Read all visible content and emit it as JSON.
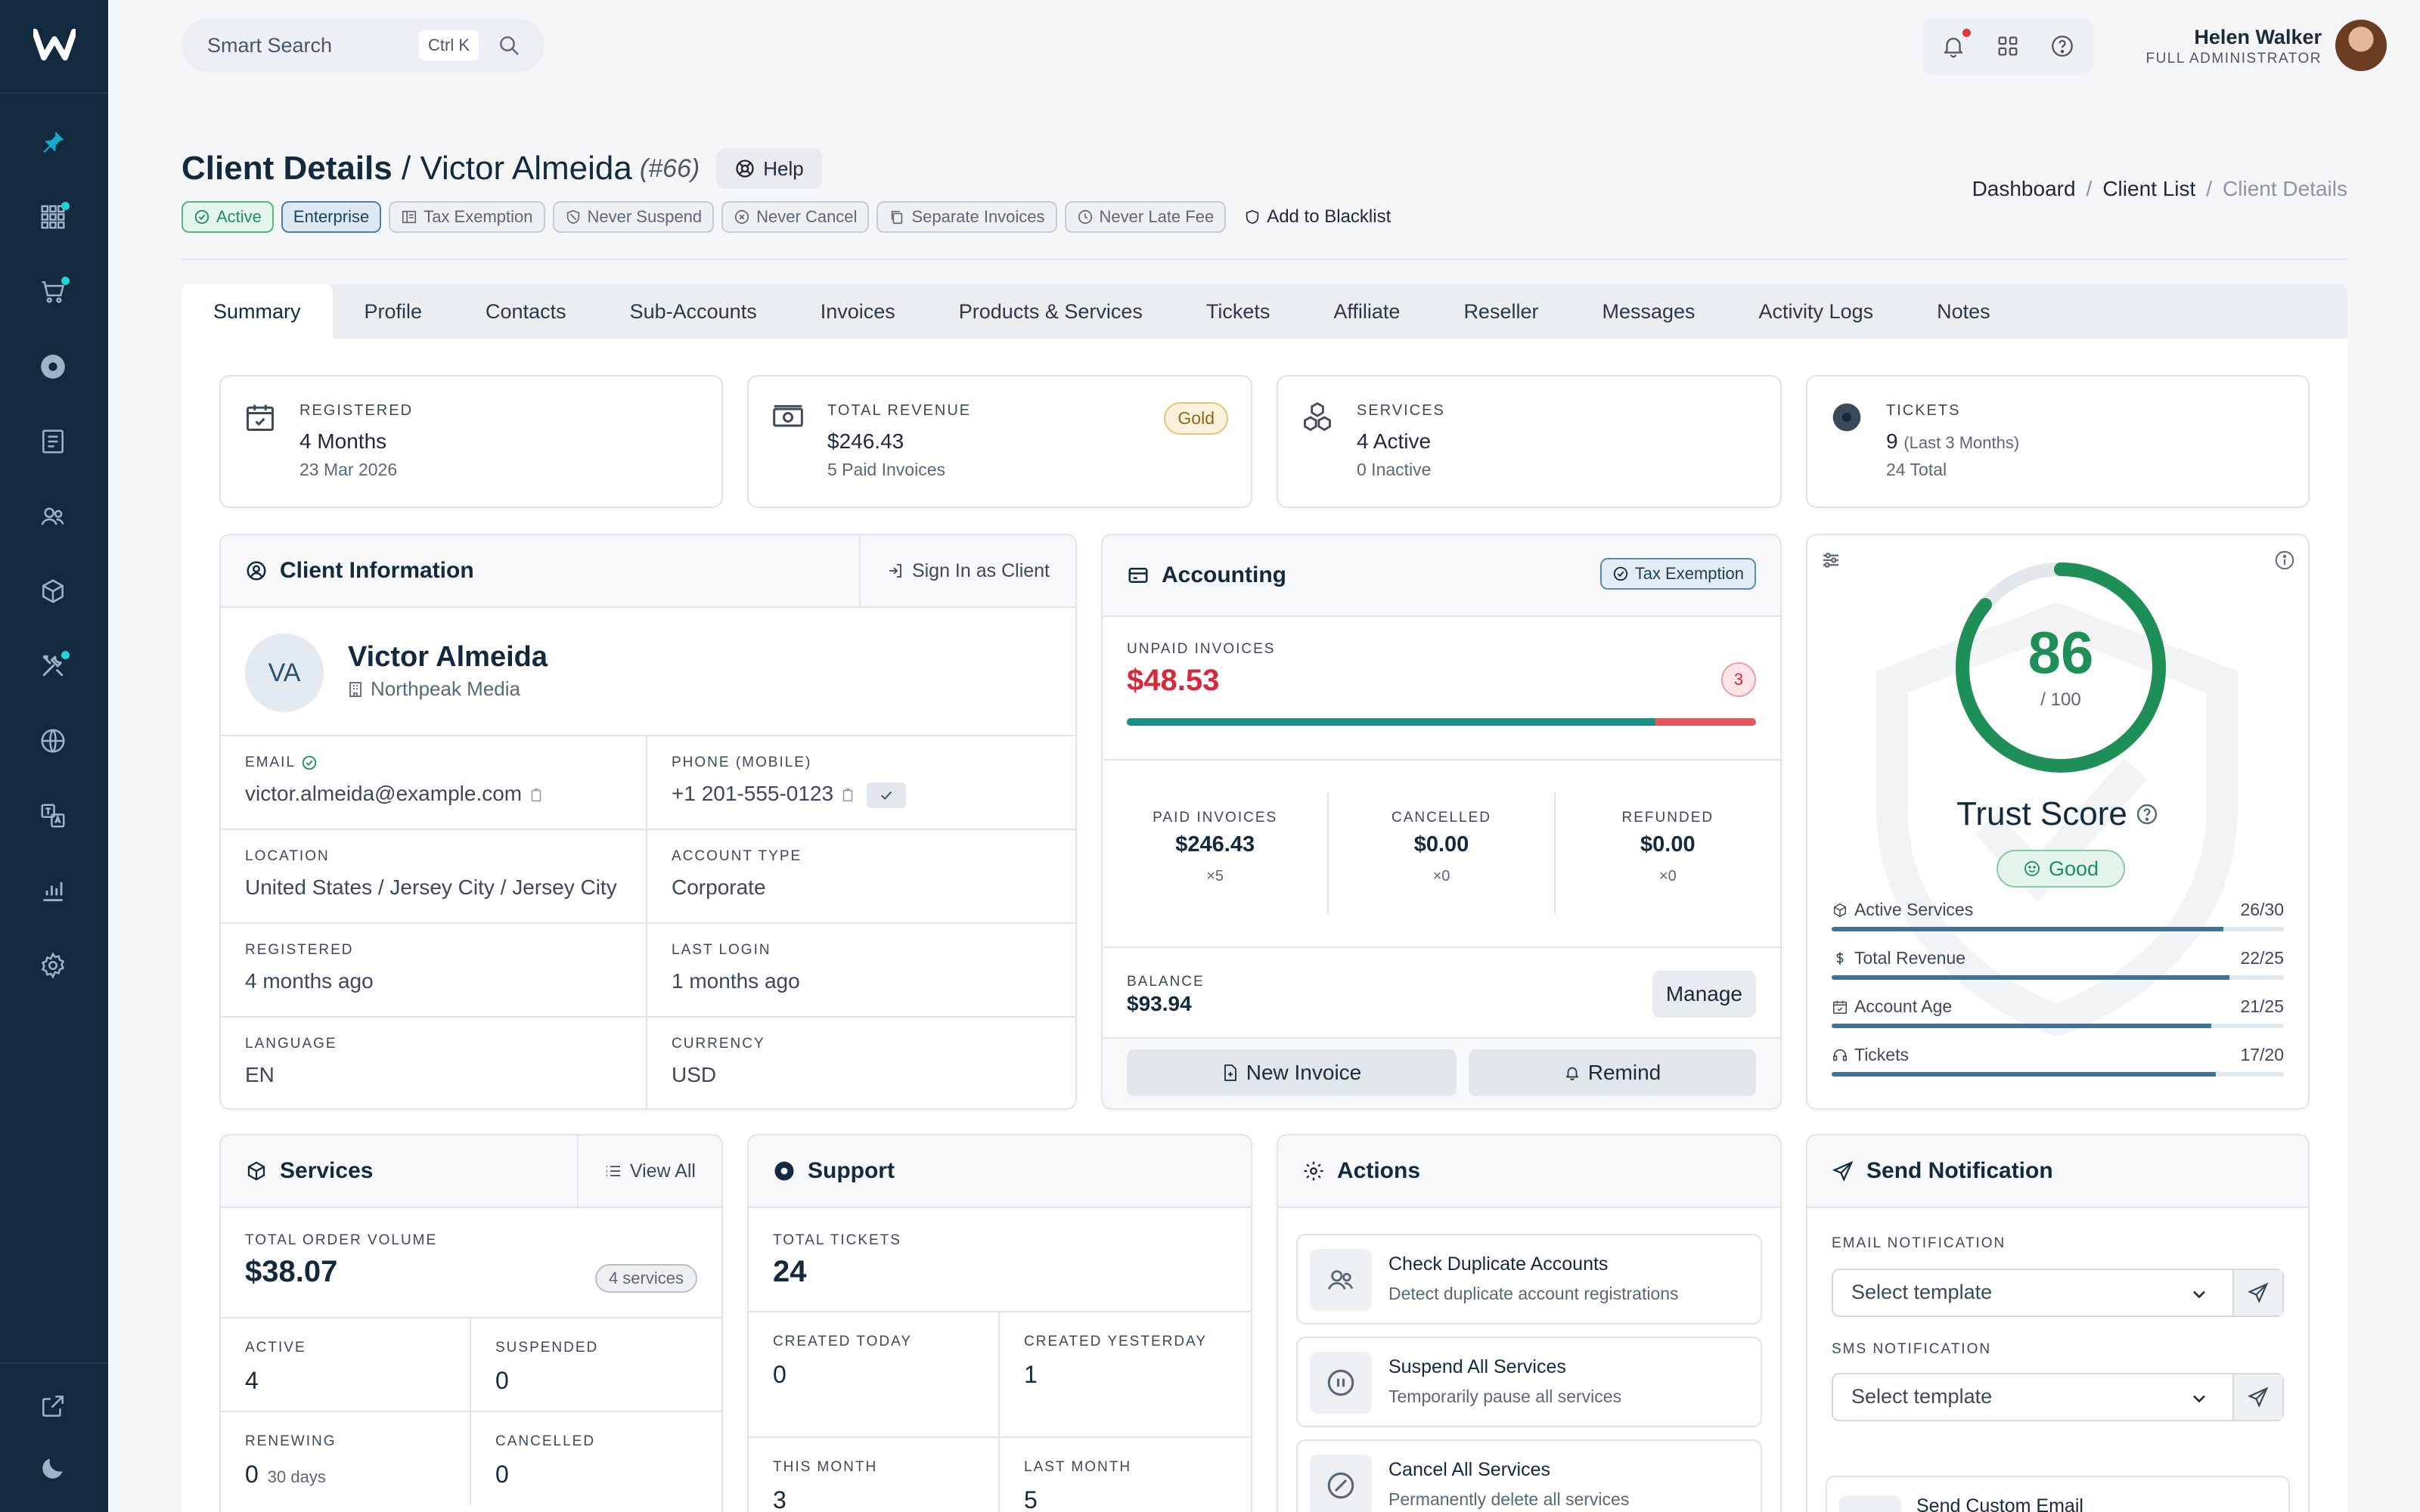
{
  "app": {
    "brand": "W"
  },
  "sidebar": {
    "items": [
      {
        "name": "pin",
        "icon": "pin-icon"
      },
      {
        "name": "apps",
        "icon": "grid-icon",
        "dot": true
      },
      {
        "name": "orders",
        "icon": "cart-icon",
        "dot": true
      },
      {
        "name": "support",
        "icon": "lifebuoy-icon"
      },
      {
        "name": "billing",
        "icon": "invoice-icon"
      },
      {
        "name": "clients",
        "icon": "users-icon"
      },
      {
        "name": "products",
        "icon": "box-icon"
      },
      {
        "name": "tools",
        "icon": "tools-icon",
        "dot": true
      },
      {
        "name": "domains",
        "icon": "globe-icon"
      },
      {
        "name": "translations",
        "icon": "translate-icon"
      },
      {
        "name": "reports",
        "icon": "chart-icon"
      },
      {
        "name": "settings",
        "icon": "gear-icon"
      }
    ],
    "bottom": [
      {
        "icon": "external-link-icon"
      },
      {
        "icon": "moon-icon"
      }
    ]
  },
  "topbar": {
    "search_placeholder": "Smart Search",
    "search_shortcut": "Ctrl K",
    "user_name": "Helen Walker",
    "user_role": "FULL ADMINISTRATOR"
  },
  "header": {
    "title": "Client Details",
    "separator": " / ",
    "client_name": "Victor Almeida",
    "client_id": "(#66)",
    "help_label": "Help",
    "tags": [
      {
        "label": "Active",
        "style": "green",
        "icon": "check-circle-icon"
      },
      {
        "label": "Enterprise",
        "style": "blue",
        "icon": ""
      },
      {
        "label": "Tax Exemption",
        "style": "grey",
        "icon": "receipt-icon"
      },
      {
        "label": "Never Suspend",
        "style": "grey",
        "icon": "shield-off-icon"
      },
      {
        "label": "Never Cancel",
        "style": "grey",
        "icon": "x-circle-icon"
      },
      {
        "label": "Separate Invoices",
        "style": "grey",
        "icon": "copy-icon"
      },
      {
        "label": "Never Late Fee",
        "style": "grey",
        "icon": "clock-icon"
      },
      {
        "label": "Add to Blacklist",
        "style": "plain",
        "icon": "shield-icon"
      }
    ],
    "breadcrumb": [
      "Dashboard",
      "Client List",
      "Client Details"
    ]
  },
  "tabs": [
    "Summary",
    "Profile",
    "Contacts",
    "Sub-Accounts",
    "Invoices",
    "Products & Services",
    "Tickets",
    "Affiliate",
    "Reseller",
    "Messages",
    "Activity Logs",
    "Notes"
  ],
  "stats": [
    {
      "label": "REGISTERED",
      "value": "4 Months",
      "value_extra": "",
      "sub": "23 Mar 2026",
      "icon": "calendar-icon"
    },
    {
      "label": "TOTAL REVENUE",
      "value": "$246.43",
      "value_extra": "",
      "sub": "5 Paid Invoices",
      "icon": "cash-icon",
      "badge": "Gold"
    },
    {
      "label": "SERVICES",
      "value": "4 Active",
      "value_extra": "",
      "sub": "0 Inactive",
      "icon": "boxes-icon"
    },
    {
      "label": "TICKETS",
      "value": "9",
      "value_extra": "(Last 3 Months)",
      "sub": "24 Total",
      "icon": "lifebuoy-icon"
    }
  ],
  "client_info": {
    "title": "Client Information",
    "sign_in": "Sign In as Client",
    "initials": "VA",
    "name": "Victor Almeida",
    "company": "Northpeak Media",
    "fields": [
      {
        "label": "EMAIL",
        "value": "victor.almeida@example.com"
      },
      {
        "label": "PHONE (MOBILE)",
        "value": "+1 201-555-0123"
      },
      {
        "label": "LOCATION",
        "value": "United States / Jersey City / Jersey City"
      },
      {
        "label": "ACCOUNT TYPE",
        "value": "Corporate"
      },
      {
        "label": "REGISTERED",
        "value": "4 months ago"
      },
      {
        "label": "LAST LOGIN",
        "value": "1 months ago"
      },
      {
        "label": "LANGUAGE",
        "value": "EN"
      },
      {
        "label": "CURRENCY",
        "value": "USD"
      }
    ]
  },
  "accounting": {
    "title": "Accounting",
    "tax_badge": "Tax Exemption",
    "unpaid_label": "UNPAID INVOICES",
    "unpaid_amount": "$48.53",
    "unpaid_count": "3",
    "paid_ratio": 0.84,
    "stats": [
      {
        "label": "PAID INVOICES",
        "value": "$246.43",
        "count": "×5"
      },
      {
        "label": "CANCELLED",
        "value": "$0.00",
        "count": "×0"
      },
      {
        "label": "REFUNDED",
        "value": "$0.00",
        "count": "×0"
      }
    ],
    "balance_label": "BALANCE",
    "balance": "$93.94",
    "manage": "Manage",
    "new_invoice": "New Invoice",
    "remind": "Remind"
  },
  "trust": {
    "score": "86",
    "score_value": 86,
    "of": "/ 100",
    "title": "Trust Score",
    "rating": "Good",
    "color": "#1f8f58",
    "metrics": [
      {
        "label": "Active Services",
        "value": "26/30",
        "ratio": 0.8667,
        "icon": "box-icon"
      },
      {
        "label": "Total Revenue",
        "value": "22/25",
        "ratio": 0.88,
        "icon": "dollar-icon"
      },
      {
        "label": "Account Age",
        "value": "21/25",
        "ratio": 0.84,
        "icon": "calendar-icon"
      },
      {
        "label": "Tickets",
        "value": "17/20",
        "ratio": 0.85,
        "icon": "headset-icon"
      }
    ]
  },
  "services": {
    "title": "Services",
    "view_all": "View All",
    "tov_label": "TOTAL ORDER VOLUME",
    "tov": "$38.07",
    "count_pill": "4 services",
    "cells": [
      {
        "label": "ACTIVE",
        "value": "4",
        "extra": ""
      },
      {
        "label": "SUSPENDED",
        "value": "0",
        "extra": ""
      },
      {
        "label": "RENEWING",
        "value": "0",
        "extra": "30 days"
      },
      {
        "label": "CANCELLED",
        "value": "0",
        "extra": ""
      }
    ]
  },
  "support": {
    "title": "Support",
    "total_label": "TOTAL TICKETS",
    "total": "24",
    "cells": [
      {
        "label": "CREATED TODAY",
        "value": "0"
      },
      {
        "label": "CREATED YESTERDAY",
        "value": "1"
      },
      {
        "label": "THIS MONTH",
        "value": "3"
      },
      {
        "label": "LAST MONTH",
        "value": "5"
      }
    ]
  },
  "actions": {
    "title": "Actions",
    "items": [
      {
        "title": "Check Duplicate Accounts",
        "desc": "Detect duplicate account registrations",
        "icon": "users-icon"
      },
      {
        "title": "Suspend All Services",
        "desc": "Temporarily pause all services",
        "icon": "pause-icon"
      },
      {
        "title": "Cancel All Services",
        "desc": "Permanently delete all services",
        "icon": "ban-icon"
      }
    ]
  },
  "notification": {
    "title": "Send Notification",
    "email_label": "EMAIL NOTIFICATION",
    "email_placeholder": "Select template",
    "sms_label": "SMS NOTIFICATION",
    "sms_placeholder": "Select template",
    "custom_email": "Send Custom Email"
  }
}
